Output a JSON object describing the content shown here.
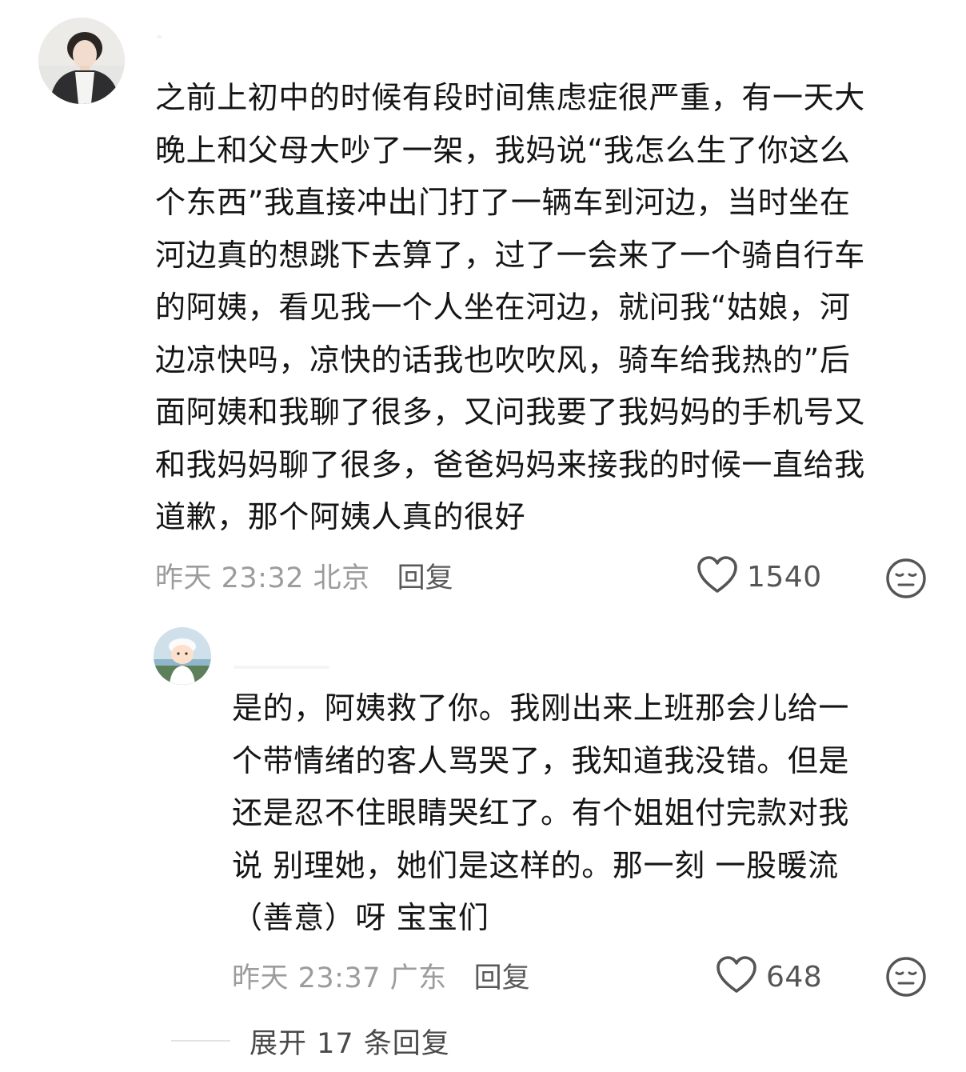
{
  "comment": {
    "lines": [
      "之前上初中的时候有段时间焦虑症很严重，有一天大",
      "晚上和父母大吵了一架，我妈说“我怎么生了你这么",
      "个东西”我直接冲出门打了一辆车到河边，当时坐在",
      "河边真的想跳下去算了，过了一会来了一个骑自行车",
      "的阿姨，看见我一个人坐在河边，就问我“姑娘，河",
      "边凉快吗，凉快的话我也吹吹风，骑车给我热的”后",
      "面阿姨和我聊了很多，又问我要了我妈妈的手机号又",
      "和我妈妈聊了很多，爸爸妈妈来接我的时候一直给我",
      "道歉，那个阿姨人真的很好"
    ],
    "time_location": "昨天 23:32 北京",
    "reply_label": "回复",
    "like_count": "1540",
    "like_icon": "heart-outline-icon",
    "dislike_icon": "meh-face-icon"
  },
  "reply": {
    "lines": [
      "是的，阿姨救了你。我刚出来上班那会儿给一",
      "个带情绪的客人骂哭了，我知道我没错。但是",
      "还是忍不住眼睛哭红了。有个姐姐付完款对我",
      "说 别理她，她们是这样的。那一刻 一股暖流",
      "（善意）呀 宝宝们"
    ],
    "time_location": "昨天 23:37 广东",
    "reply_label": "回复",
    "like_count": "648",
    "like_icon": "heart-outline-icon",
    "dislike_icon": "meh-face-icon"
  },
  "expand_replies": {
    "label": "展开 17 条回复"
  },
  "colors": {
    "text": "#151515",
    "meta_gray": "#9c9c9c",
    "icon_gray": "#555555"
  }
}
